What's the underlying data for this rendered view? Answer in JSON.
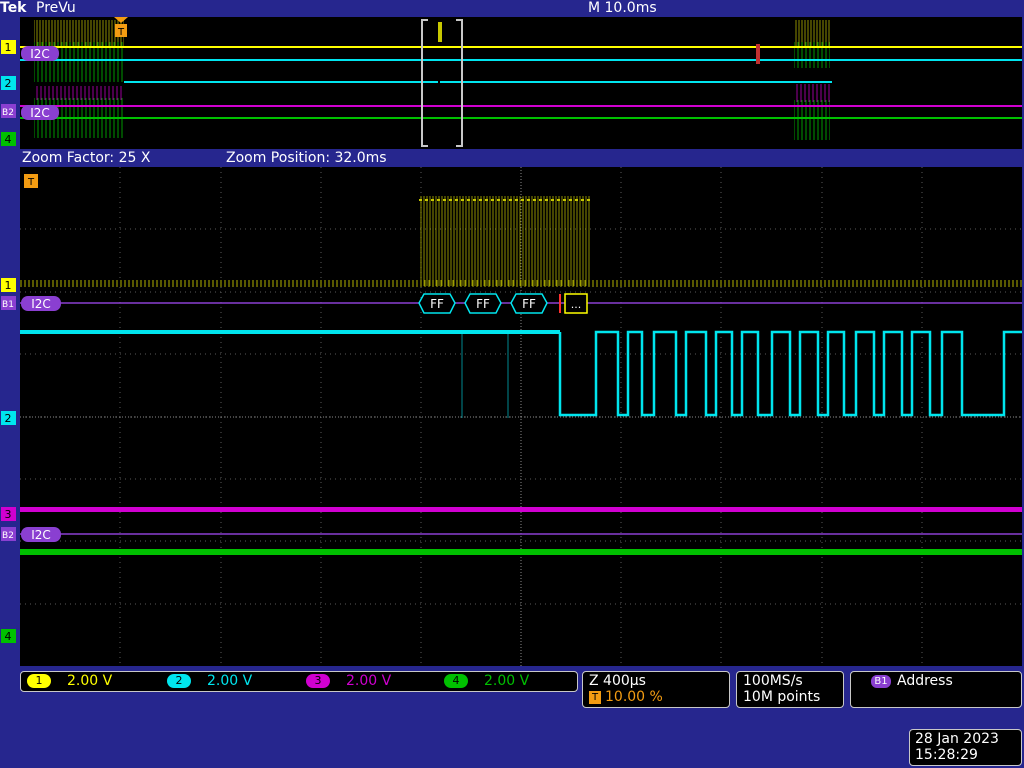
{
  "header": {
    "brand": "Tek",
    "mode": "PreVu",
    "horizontal_scale": "M 10.0ms"
  },
  "zoom": {
    "factor": "Zoom Factor: 25 X",
    "position": "Zoom Position: 32.0ms"
  },
  "markers": {
    "trigger": "T",
    "ch1": "1",
    "ch2": "2",
    "ch3": "3",
    "ch4": "4",
    "bus1": "B1",
    "bus2": "B2",
    "bus_type": "I2C"
  },
  "decode": {
    "packets": [
      "FF",
      "FF",
      "FF"
    ],
    "more": "..."
  },
  "channels": [
    {
      "num": "1",
      "scale": "2.00 V",
      "color": "#ffff00"
    },
    {
      "num": "2",
      "scale": "2.00 V",
      "color": "#00e5ee"
    },
    {
      "num": "3",
      "scale": "2.00 V",
      "color": "#d000d0"
    },
    {
      "num": "4",
      "scale": "2.00 V",
      "color": "#00c000"
    }
  ],
  "timebase": {
    "zoom": "Z 400µs",
    "trigger_label": "T",
    "trigger_pos": "10.00 %"
  },
  "acquisition": {
    "rate": "100MS/s",
    "record": "10M points"
  },
  "bus_trigger": {
    "bus": "B1",
    "label": "Address"
  },
  "datetime": {
    "date": "28 Jan  2023",
    "time": "15:28:29"
  },
  "colors": {
    "ch1": "#ffff00",
    "ch2": "#00e5ee",
    "ch3": "#d000d0",
    "ch4": "#00c000",
    "bus": "#8a3fd1",
    "trigger": "#f39c12",
    "background": "#26268e",
    "screen": "#000000"
  }
}
